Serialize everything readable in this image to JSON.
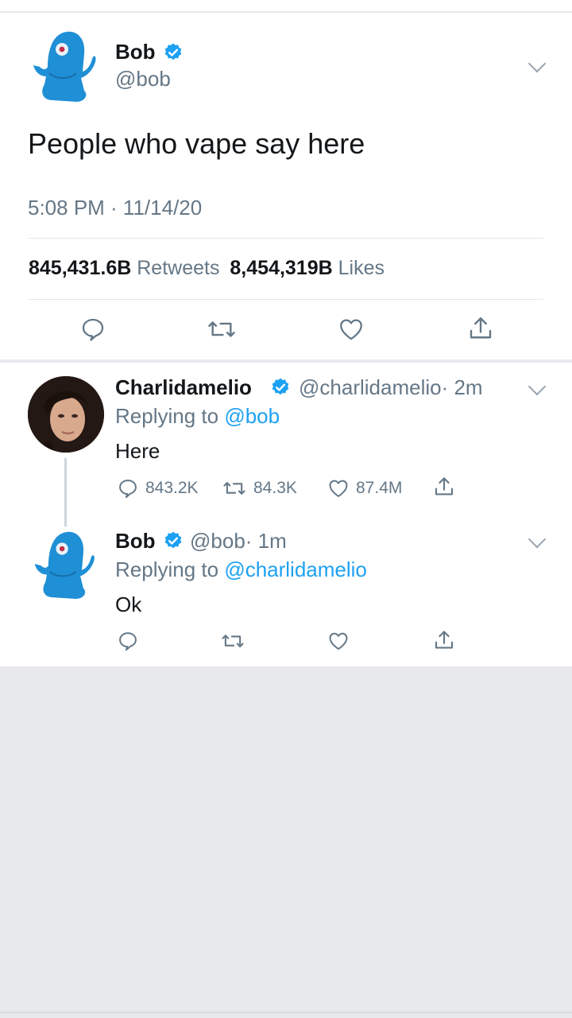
{
  "main_tweet": {
    "author_name": "Bob",
    "author_handle": "@bob",
    "text": "People who vape say here",
    "timestamp": "5:08 PM · 11/14/20",
    "retweets_count": "845,431.6B",
    "retweets_label": "Retweets",
    "likes_count": "8,454,319B",
    "likes_label": "Likes"
  },
  "replies": [
    {
      "author_name": "Charlidamelio",
      "author_handle": "@charlidamelio",
      "time": "· 2m",
      "replying_prefix": "Replying to",
      "replying_to": "@bob",
      "text": "Here",
      "reply_count": "843.2K",
      "retweet_count": "84.3K",
      "like_count": "87.4M"
    },
    {
      "author_name": "Bob",
      "author_handle": "@bob",
      "time": "· 1m",
      "replying_prefix": "Replying to",
      "replying_to": "@charlidamelio",
      "text": "Ok"
    }
  ],
  "colors": {
    "accent": "#1da1f2",
    "secondary_text": "#657786",
    "background_empty": "#e8e9ed"
  }
}
